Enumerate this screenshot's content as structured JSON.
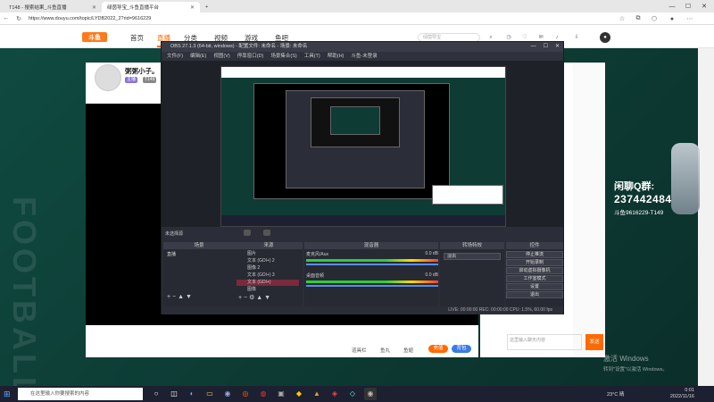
{
  "browser": {
    "tabs": [
      {
        "label": "T148 - 搜索结果_斗鱼直播",
        "active": false
      },
      {
        "label": "绿茵导宝_斗鱼直播平台",
        "active": true
      }
    ],
    "new_tab": "+",
    "url": "https://www.douyu.com/topic/LYDB2022_2?rid=9616229",
    "controls": {
      "minimize": "—",
      "maximize": "☐",
      "close": "✕"
    }
  },
  "site": {
    "logo": "斗鱼",
    "nav": [
      "首页",
      "直播",
      "分类",
      "视频",
      "游戏",
      "鱼吧"
    ],
    "active_nav": "直播",
    "search_placeholder": "绿茵导宝"
  },
  "anchor": {
    "name": "粥粥小子。",
    "badges": [
      "主播",
      "T149"
    ]
  },
  "obs": {
    "title": "OBS 27.1.3 (64-bit, windows) - 配置文件: 未命名 - 场景: 未命名",
    "menu": [
      "文件(F)",
      "编辑(E)",
      "视图(V)",
      "停靠窗口(D)",
      "场景集合(S)",
      "工具(T)",
      "帮助(H)",
      "斗鱼-未登录"
    ],
    "no_source": "未选择源",
    "docks": {
      "scenes": "场景",
      "sources": "来源",
      "mixer": "混音器",
      "transitions": "转场特效",
      "controls": "控件"
    },
    "scene_items": [
      "直播"
    ],
    "sources": [
      "图片",
      "文本 (GDI+) 2",
      "图像 2",
      "文本 (GDI+) 3",
      "文本 (GDI+)",
      "图像"
    ],
    "mixer": [
      {
        "name": "麦克风/Aux",
        "db": "0.0 dB"
      },
      {
        "name": "桌面音频",
        "db": "0.0 dB"
      }
    ],
    "transition": "淡出",
    "controls_buttons": [
      "停止推流",
      "开始录制",
      "启动虚拟摄像机",
      "工作室模式",
      "设置",
      "退出"
    ],
    "status": "LIVE: 00:00:00   REC: 00:00:00   CPU: 1.5%, 60.00 fps"
  },
  "bottom": {
    "labels": [
      "道具栏",
      "鱼丸",
      "鱼翅"
    ],
    "buttons": [
      "充值",
      "背包"
    ]
  },
  "chat": {
    "input_placeholder": "这里输入聊天内容",
    "send": "发送"
  },
  "qq_overlay": {
    "title": "闲聊Q群:",
    "number": "237442484",
    "room": "斗鱼9616229-T149"
  },
  "watermark": {
    "line1": "激活 Windows",
    "line2": "转到\"设置\"以激活 Windows。"
  },
  "taskbar": {
    "search": "在这里输入你要搜索的内容",
    "weather": "23°C 晴",
    "time": "0:01",
    "date": "2022/11/16"
  },
  "side_text": "FOOTBALL",
  "colors": {
    "accent": "#ff6a00",
    "bg_green": "#0d3a33",
    "obs_bg": "#2b2e38"
  }
}
